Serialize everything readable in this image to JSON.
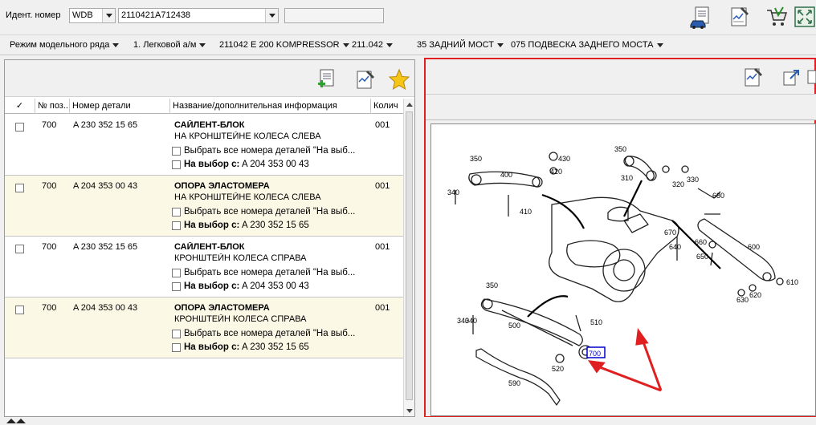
{
  "ident": {
    "label": "Идент. номер",
    "prefix": "WDB",
    "number": "2110421A712438",
    "extra": ""
  },
  "toolbar_icons": [
    "car-document-icon",
    "edit-note-icon",
    "cart-icon",
    "fullscreen-icon"
  ],
  "breadcrumb": [
    "Режим модельного ряда",
    "1. Легковой а/м",
    "211042 E 200 KOMPRESSOR",
    "211.042",
    "35 ЗАДНИЙ МОСТ",
    "075 ПОДВЕСКА ЗАДНЕГО МОСТА"
  ],
  "parts_table": {
    "columns": [
      "✓",
      "№ поз...",
      "Номер детали",
      "Название/дополнительная информация",
      "Колич"
    ],
    "rows": [
      {
        "pos": "700",
        "part": "A 230 352 15 65",
        "name": "САЙЛЕНТ-БЛОК",
        "info": "НА КРОНШТЕЙНЕ КОЛЕСА СЛЕВА",
        "select_all": "Выбрать все номера деталей \"На выб...",
        "alt_label": "На выбор с:",
        "alt_part": "A 204 353 00 43",
        "qty": "001"
      },
      {
        "pos": "700",
        "part": "A 204 353 00 43",
        "name": "ОПОРА ЭЛАСТОМЕРА",
        "info": "НА КРОНШТЕЙНЕ КОЛЕСА СЛЕВА",
        "select_all": "Выбрать все номера деталей \"На выб...",
        "alt_label": "На выбор с:",
        "alt_part": "A 230 352 15 65",
        "qty": "001"
      },
      {
        "pos": "700",
        "part": "A 230 352 15 65",
        "name": "САЙЛЕНТ-БЛОК",
        "info": "КРОНШТЕЙН КОЛЕСА СПРАВА",
        "select_all": "Выбрать все номера деталей \"На выб...",
        "alt_label": "На выбор с:",
        "alt_part": "A 204 353 00 43",
        "qty": "001"
      },
      {
        "pos": "700",
        "part": "A 204 353 00 43",
        "name": "ОПОРА ЭЛАСТОМЕРА",
        "info": "КРОНШТЕЙН КОЛЕСА СПРАВА",
        "select_all": "Выбрать все номера деталей \"На выб...",
        "alt_label": "На выбор с:",
        "alt_part": "A 230 352 15 65",
        "qty": "001"
      }
    ]
  },
  "diagram": {
    "labels": [
      "350",
      "400",
      "430",
      "420",
      "340",
      "410",
      "350",
      "340",
      "310",
      "320",
      "330",
      "680",
      "670",
      "640",
      "660",
      "650",
      "600",
      "610",
      "620",
      "630",
      "350",
      "340",
      "500",
      "510",
      "520",
      "590",
      "700"
    ],
    "highlighted": "700"
  },
  "colors": {
    "panel_border": "#e02020",
    "alt_row": "#fcf8e6",
    "highlight": "#0000cc",
    "arrow": "#e02020"
  }
}
